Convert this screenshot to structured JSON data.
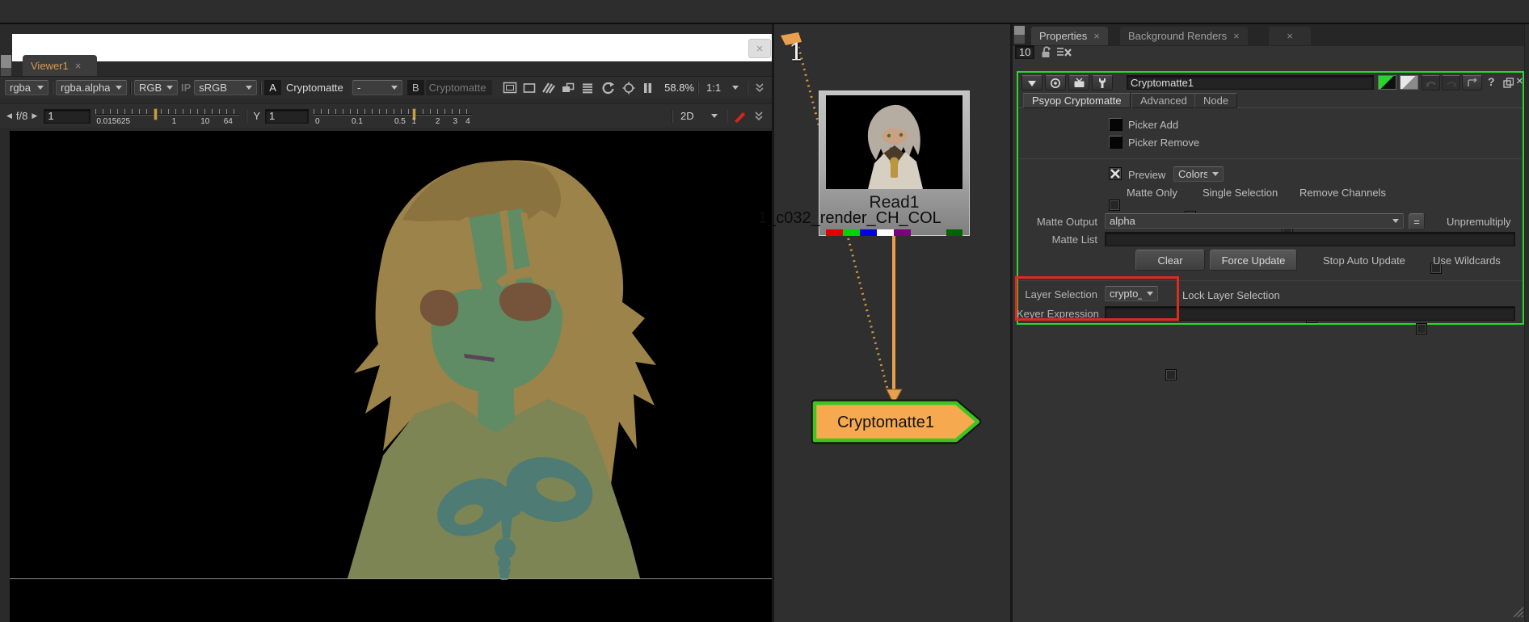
{
  "glyphs": {
    "close": "×",
    "tri_left": "◀",
    "tri_right": "▶"
  },
  "viewer": {
    "tab_label": "Viewer1",
    "layer_dd": "rgba",
    "alpha_dd": "rgba.alpha",
    "display_dd": "RGB",
    "ip_toggle": "IP",
    "colorspace_dd": "sRGB",
    "a_label": "A",
    "a_buffer": "Cryptomatte",
    "blend_dd": "-",
    "b_label": "B",
    "b_buffer": "Cryptomatte",
    "zoom_level": "58.8%",
    "proxy": "1:1",
    "fstop": "f/8",
    "gain_value": "1",
    "gain_ticks": [
      "0.015625",
      "1",
      "10",
      "64"
    ],
    "gamma_label": "Y",
    "gamma_value": "1",
    "gamma_ticks": [
      "0",
      "0.1",
      "0.5",
      "1",
      "2",
      "3",
      "4"
    ],
    "view_dd": "2D"
  },
  "node_graph": {
    "viewer_input": "1",
    "read_node_name": "Read1",
    "read_node_file": "1_c032_render_CH_COL",
    "channel_colors": [
      "#e10000",
      "#00d400",
      "#0000e1",
      "#ffffff",
      "#7a0080",
      "#006400"
    ],
    "crypto_node_name": "Cryptomatte1"
  },
  "properties": {
    "tab1": "Properties",
    "tab2": "Background Renders",
    "panel_count": "10",
    "node_name": "Cryptomatte1",
    "tab_psyop": "Psyop Cryptomatte",
    "tab_advanced": "Advanced",
    "tab_node": "Node",
    "picker_add": "Picker Add",
    "picker_remove": "Picker Remove",
    "preview": "Preview",
    "preview_mode": "Colors",
    "matte_only": "Matte Only",
    "single_selection": "Single Selection",
    "remove_channels": "Remove Channels",
    "matte_output": "Matte Output",
    "matte_output_value": "alpha",
    "equals": "=",
    "unpremultiply": "Unpremultiply",
    "matte_list": "Matte List",
    "clear": "Clear",
    "force_update": "Force Update",
    "stop_auto_update": "Stop Auto Update",
    "use_wildcards": "Use Wildcards",
    "layer_selection": "Layer Selection",
    "layer_selection_value": "crypto_m",
    "lock_layer_selection": "Lock Layer Selection",
    "keyer_expression": "Keyer Expression",
    "help": "?"
  },
  "colors": {
    "connection_orange": "#e8a04e",
    "crypto_node_fill": "#f6a94f",
    "crypto_node_border": "#3ec51f",
    "annotation_red": "#dd2b1e",
    "panel_focus_green": "#2bd72b"
  },
  "art": {
    "hair": "#9c8349",
    "hair_dark": "#8b7340",
    "face": "#5f8c64",
    "eye": "#75543b",
    "mouth": "#5a4458",
    "body": "#7d8555",
    "bow": "#4e7b74"
  },
  "art_thumb": {
    "hair": "#b5ada2",
    "face": "#c9a183",
    "collar": "#4a3a28",
    "robe": "#d6cfc2",
    "gold": "#bb9540"
  }
}
